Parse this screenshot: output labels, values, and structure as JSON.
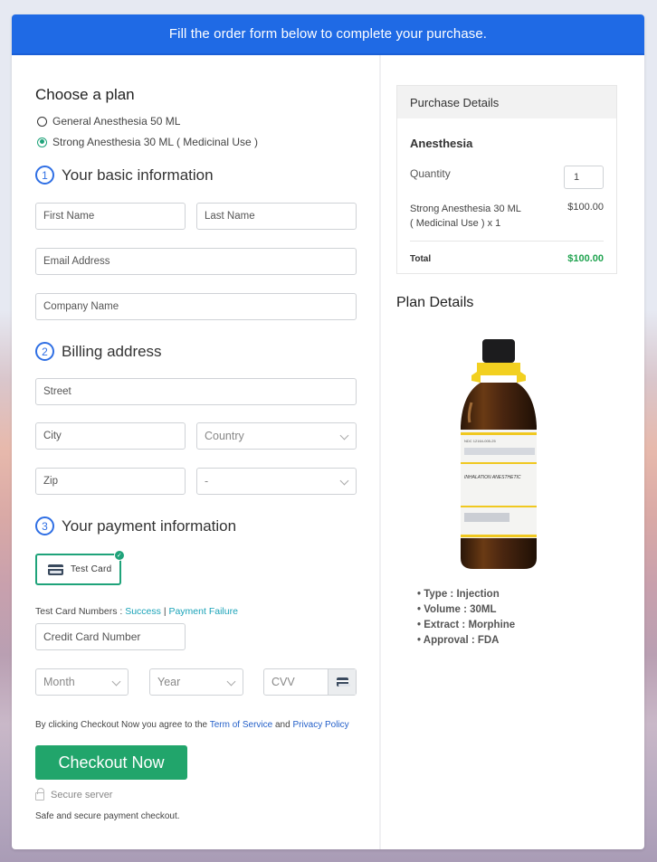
{
  "banner": {
    "text": "Fill the order form below to complete your purchase."
  },
  "plan": {
    "heading": "Choose a plan",
    "options": [
      {
        "label": "General Anesthesia 50 ML",
        "selected": false
      },
      {
        "label": "Strong Anesthesia 30 ML ( Medicinal Use )",
        "selected": true
      }
    ]
  },
  "steps": [
    {
      "num": "1",
      "title": "Your basic information"
    },
    {
      "num": "2",
      "title": "Billing address"
    },
    {
      "num": "3",
      "title": "Your payment information"
    }
  ],
  "basic": {
    "first_name": "First Name",
    "last_name": "Last Name",
    "email": "Email Address",
    "company": "Company Name"
  },
  "billing": {
    "street": "Street",
    "city": "City",
    "country": "Country",
    "zip": "Zip",
    "state": "-"
  },
  "payment": {
    "method_label": "Test Card",
    "test_numbers_label": "Test Card Numbers :",
    "success_link": "Success",
    "separator": "|",
    "failure_link": "Payment Failure",
    "card_number": "Credit Card Number",
    "month": "Month",
    "year": "Year",
    "cvv": "CVV"
  },
  "footer": {
    "agree_prefix": "By clicking Checkout Now you agree to the",
    "terms_link": "Term of Service",
    "and": "and",
    "privacy_link": "Privacy Policy",
    "checkout_button": "Checkout Now",
    "secure_server": "Secure server",
    "safe_text": "Safe and secure payment checkout."
  },
  "purchase": {
    "heading": "Purchase Details",
    "product": "Anesthesia",
    "quantity_label": "Quantity",
    "quantity": "1",
    "item_line1": "Strong Anesthesia 30 ML",
    "item_line2": "( Medicinal Use ) x 1",
    "item_price": "$100.00",
    "total_label": "Total",
    "total": "$100.00"
  },
  "plan_details": {
    "heading": "Plan Details",
    "bottle_label_top": "NDC 12164-005-25",
    "bottle_label_mid": "INHALATION ANESTHETIC",
    "features": [
      "Type : Injection",
      "Volume : 30ML",
      "Extract : Morphine",
      "Approval : FDA"
    ]
  },
  "colors": {
    "banner": "#1f6ae5",
    "accent_green": "#21a56b",
    "total_green": "#1fa34f",
    "step_blue": "#2f6fe4",
    "link_teal": "#1aa3b8",
    "link_blue": "#2460c9"
  }
}
